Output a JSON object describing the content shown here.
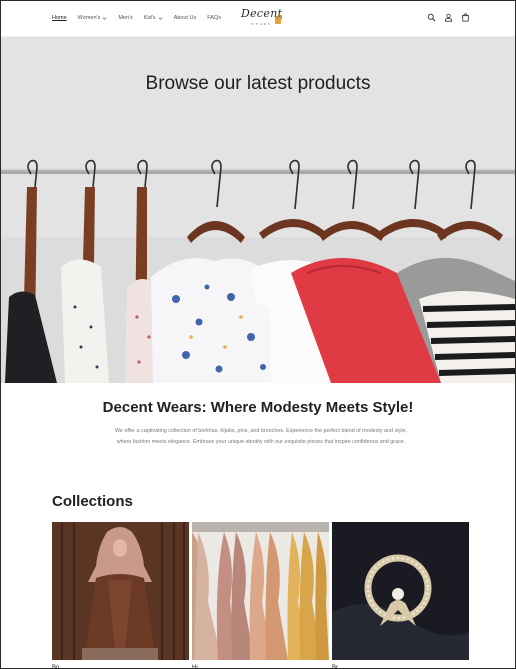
{
  "header": {
    "nav": [
      {
        "label": "Home",
        "has_dropdown": false,
        "active": true
      },
      {
        "label": "Women's",
        "has_dropdown": true,
        "active": false
      },
      {
        "label": "Men's",
        "has_dropdown": false,
        "active": false
      },
      {
        "label": "Kid's",
        "has_dropdown": true,
        "active": false
      },
      {
        "label": "About Us",
        "has_dropdown": false,
        "active": false
      },
      {
        "label": "FAQs",
        "has_dropdown": false,
        "active": false
      }
    ],
    "logo": {
      "name": "Decent",
      "sub": "WEARS"
    },
    "icons": [
      "search-icon",
      "account-icon",
      "cart-icon"
    ]
  },
  "hero": {
    "title": "Browse our latest products"
  },
  "intro": {
    "title": "Decent Wears: Where Modesty Meets Style!",
    "text": "We offer a captivating collection of borkhas, hijabs, pins, and brooches. Experience the perfect blend of modesty and style, where fashion meets elegance. Embrace your unique identity with our exquisite pieces that inspire confidence and grace."
  },
  "collections": {
    "title": "Collections",
    "items": [
      {
        "name": "borkhas",
        "label": "Bo"
      },
      {
        "name": "hijabs",
        "label": "Hi"
      },
      {
        "name": "brooches",
        "label": "Br"
      }
    ]
  },
  "colors": {
    "accent": "#e2a13b",
    "text": "#222222",
    "muted": "#777777"
  }
}
